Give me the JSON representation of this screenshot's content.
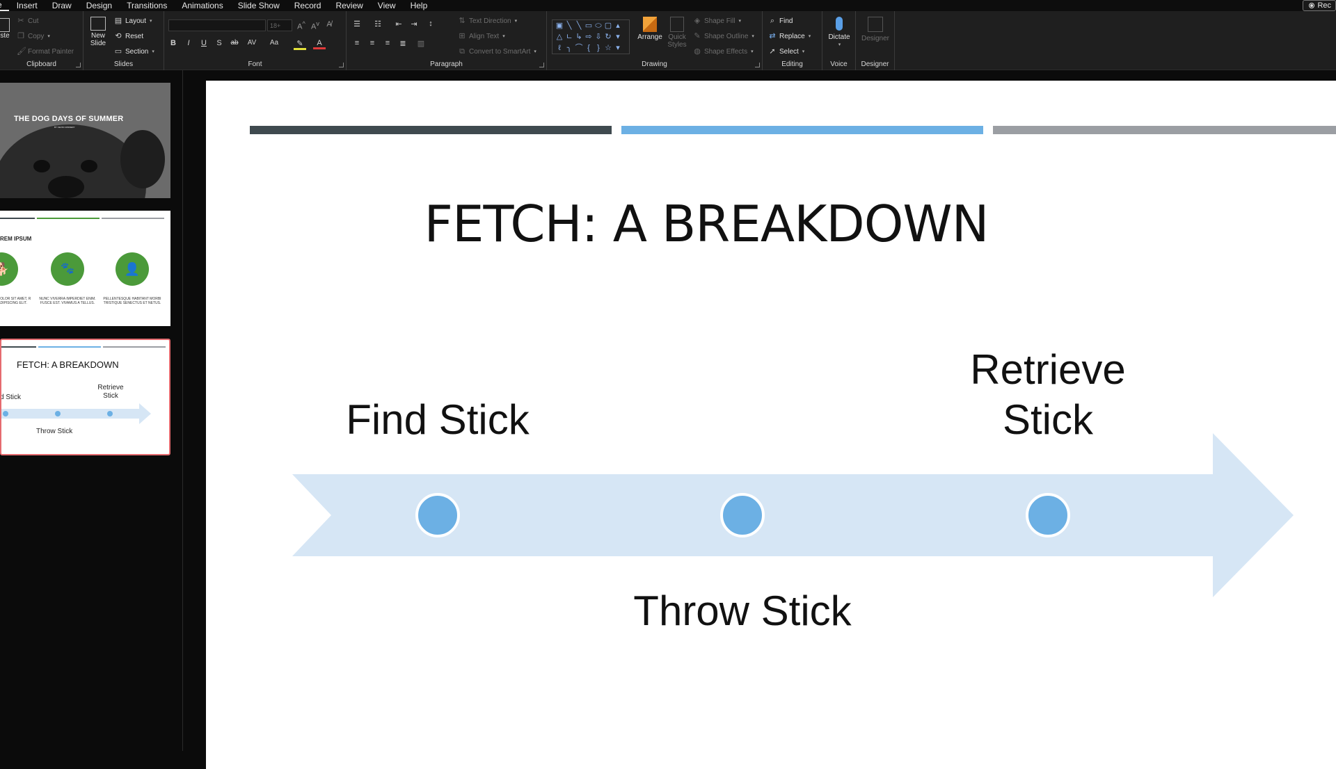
{
  "menu": {
    "items": [
      "e",
      "Insert",
      "Draw",
      "Design",
      "Transitions",
      "Animations",
      "Slide Show",
      "Record",
      "Review",
      "View",
      "Help"
    ],
    "record_button": "Rec"
  },
  "ribbon": {
    "clipboard": {
      "paste": "ste",
      "cut": "Cut",
      "copy": "Copy",
      "format_painter": "Format Painter",
      "label": "Clipboard"
    },
    "slides": {
      "new_slide": "New Slide",
      "layout": "Layout",
      "reset": "Reset",
      "section": "Section",
      "label": "Slides"
    },
    "font": {
      "font_size": "18+",
      "label": "Font",
      "bold": "B",
      "italic": "I",
      "underline": "U",
      "shadow": "S",
      "strike": "ab",
      "spacing": "AV",
      "case": "Aa"
    },
    "paragraph": {
      "text_direction": "Text Direction",
      "align_text": "Align Text",
      "convert_smartart": "Convert to SmartArt",
      "label": "Paragraph"
    },
    "drawing": {
      "arrange": "Arrange",
      "quick_styles": "Quick Styles",
      "shape_fill": "Shape Fill",
      "shape_outline": "Shape Outline",
      "shape_effects": "Shape Effects",
      "label": "Drawing"
    },
    "editing": {
      "find": "Find",
      "replace": "Replace",
      "select": "Select",
      "label": "Editing"
    },
    "voice": {
      "dictate": "Dictate",
      "label": "Voice"
    },
    "designer": {
      "designer": "Designer",
      "label": "Designer"
    }
  },
  "thumbnails": [
    {
      "title": "THE DOG DAYS OF SUMMER",
      "subtitle": "BY KEVIN CONNERY"
    },
    {
      "title": "REM IPSUM",
      "captions": [
        "R COLOR SIT AMET, R ADIPISCING ELIT.",
        "NUNC VIVERRA IMPERDIET ENIM. FUSCE EST. VIVAMUS A TELLUS.",
        "PELLENTESQUE HABITANT MORBI TRISTIQUE SENECTUS ET NETUS."
      ]
    },
    {
      "title": "FETCH: A BREAKDOWN",
      "find": "d Stick",
      "retrieve": "Retrieve Stick",
      "throw": "Throw Stick"
    }
  ],
  "slide": {
    "title": "FETCH: A BREAKDOWN",
    "steps": [
      {
        "label": "Find Stick"
      },
      {
        "label": "Throw Stick"
      },
      {
        "label": "Retrieve Stick"
      }
    ],
    "colors": {
      "bar1": "#3f4a4f",
      "bar2": "#6cb0e4",
      "bar3": "#9b9ea3",
      "arrow": "#d6e6f5",
      "dot": "#6cb0e4",
      "accent_green": "#4b9a3a"
    }
  }
}
